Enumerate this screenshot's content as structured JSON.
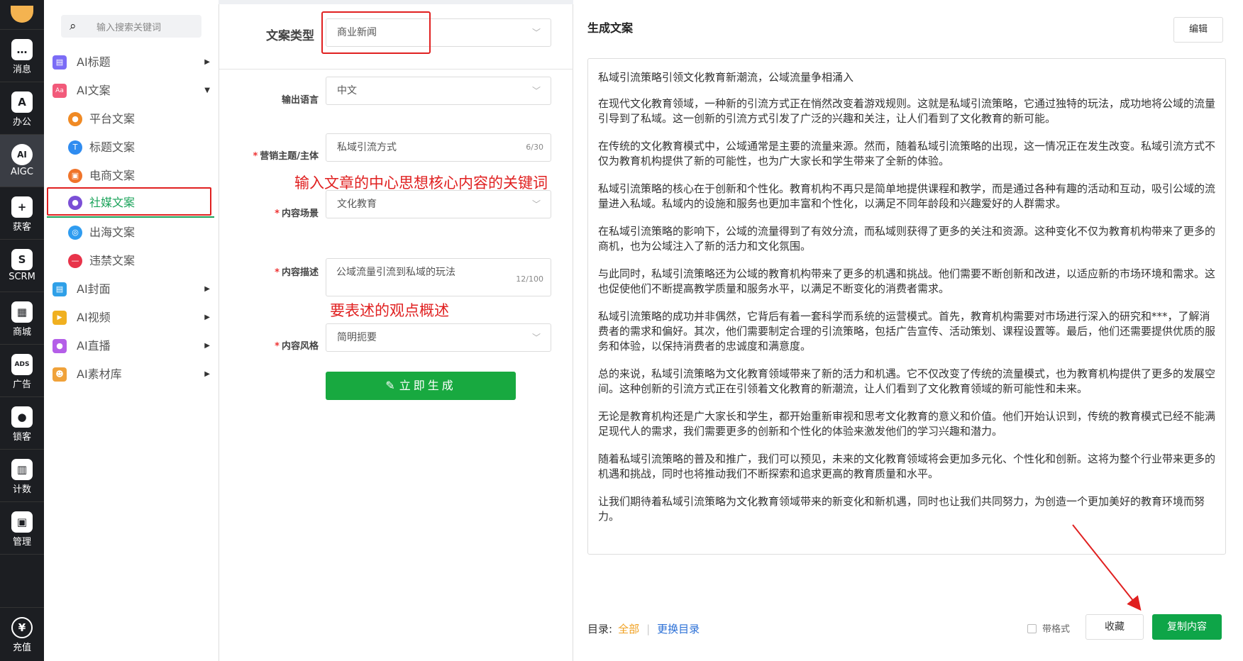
{
  "sidebar": {
    "items": [
      {
        "label": "消息",
        "icon": "chat-icon",
        "glyph": "…"
      },
      {
        "label": "办公",
        "icon": "office-icon",
        "glyph": "A"
      },
      {
        "label": "AIGC",
        "icon": "aigc-icon",
        "glyph": "AI"
      },
      {
        "label": "获客",
        "icon": "user-add-icon",
        "glyph": "+"
      },
      {
        "label": "SCRM",
        "icon": "scrm-icon",
        "glyph": "S"
      },
      {
        "label": "商城",
        "icon": "store-icon",
        "glyph": "▦"
      },
      {
        "label": "广告",
        "icon": "ads-icon",
        "glyph": "ADS"
      },
      {
        "label": "锁客",
        "icon": "lock-user-icon",
        "glyph": "●"
      },
      {
        "label": "计数",
        "icon": "count-icon",
        "glyph": "▥"
      },
      {
        "label": "管理",
        "icon": "manage-icon",
        "glyph": "▣"
      }
    ],
    "recharge": {
      "label": "充值",
      "icon": "yen-icon",
      "glyph": "¥"
    }
  },
  "menu": {
    "search_placeholder": "输入搜索关键词",
    "ai_title": {
      "label": "AI标题",
      "glyph": "▤"
    },
    "ai_copy": {
      "label": "AI文案",
      "glyph": "Aa"
    },
    "platform": {
      "label": "平台文案",
      "glyph": "●"
    },
    "headline": {
      "label": "标题文案",
      "glyph": "T"
    },
    "ecommerce": {
      "label": "电商文案",
      "glyph": "▣"
    },
    "social": {
      "label": "社媒文案",
      "glyph": "●"
    },
    "overseas": {
      "label": "出海文案",
      "glyph": "◎"
    },
    "banned": {
      "label": "违禁文案",
      "glyph": "—"
    },
    "ai_cover": {
      "label": "AI封面",
      "glyph": "▤"
    },
    "ai_video": {
      "label": "AI视频",
      "glyph": "▶"
    },
    "ai_live": {
      "label": "AI直播",
      "glyph": "●"
    },
    "ai_assets": {
      "label": "AI素材库",
      "glyph": "☻"
    }
  },
  "form": {
    "copy_type_label": "文案类型",
    "copy_type_value": "商业新闻",
    "lang_label": "输出语言",
    "lang_value": "中文",
    "topic_label": "营销主题/主体",
    "topic_value": "私域引流方式",
    "topic_counter": "6/30",
    "scene_label": "内容场景",
    "scene_value": "文化教育",
    "desc_label": "内容描述",
    "desc_value": "公域流量引流到私域的玩法",
    "desc_counter": "12/100",
    "style_label": "内容风格",
    "style_value": "简明扼要",
    "generate_label": "立即生成"
  },
  "annotations": {
    "topic_hint": "输入文章的中心思想核心内容的关键词",
    "desc_hint": "要表述的观点概述"
  },
  "output": {
    "title": "生成文案",
    "edit_label": "编辑",
    "paragraphs": [
      "私域引流策略引领文化教育新潮流，公域流量争相涌入",
      "在现代文化教育领域，一种新的引流方式正在悄然改变着游戏规则。这就是私域引流策略，它通过独特的玩法，成功地将公域的流量引导到了私域。这一创新的引流方式引发了广泛的兴趣和关注，让人们看到了文化教育的新可能。",
      "在传统的文化教育模式中，公域通常是主要的流量来源。然而，随着私域引流策略的出现，这一情况正在发生改变。私域引流方式不仅为教育机构提供了新的可能性，也为广大家长和学生带来了全新的体验。",
      "私域引流策略的核心在于创新和个性化。教育机构不再只是简单地提供课程和教学，而是通过各种有趣的活动和互动，吸引公域的流量进入私域。私域内的设施和服务也更加丰富和个性化，以满足不同年龄段和兴趣爱好的人群需求。",
      "在私域引流策略的影响下，公域的流量得到了有效分流，而私域则获得了更多的关注和资源。这种变化不仅为教育机构带来了更多的商机，也为公域注入了新的活力和文化氛围。",
      "与此同时，私域引流策略还为公域的教育机构带来了更多的机遇和挑战。他们需要不断创新和改进，以适应新的市场环境和需求。这也促使他们不断提高教学质量和服务水平，以满足不断变化的消费者需求。",
      "私域引流策略的成功并非偶然，它背后有着一套科学而系统的运营模式。首先，教育机构需要对市场进行深入的研究和***，了解消费者的需求和偏好。其次，他们需要制定合理的引流策略，包括广告宣传、活动策划、课程设置等。最后，他们还需要提供优质的服务和体验，以保持消费者的忠诚度和满意度。",
      "总的来说，私域引流策略为文化教育领域带来了新的活力和机遇。它不仅改变了传统的流量模式，也为教育机构提供了更多的发展空间。这种创新的引流方式正在引领着文化教育的新潮流，让人们看到了文化教育领域的新可能性和未来。",
      "无论是教育机构还是广大家长和学生，都开始重新审视和思考文化教育的意义和价值。他们开始认识到，传统的教育模式已经不能满足现代人的需求，我们需要更多的创新和个性化的体验来激发他们的学习兴趣和潜力。",
      "随着私域引流策略的普及和推广，我们可以预见，未来的文化教育领域将会更加多元化、个性化和创新。这将为整个行业带来更多的机遇和挑战，同时也将推动我们不断探索和追求更高的教育质量和水平。",
      "让我们期待着私域引流策略为文化教育领域带来的新变化和新机遇，同时也让我们共同努力，为创造一个更加美好的教育环境而努力。"
    ],
    "toc_label": "目录:",
    "toc_all": "全部",
    "toc_switch": "更换目录",
    "format_label": "带格式",
    "favorite_label": "收藏",
    "copy_label": "复制内容"
  }
}
